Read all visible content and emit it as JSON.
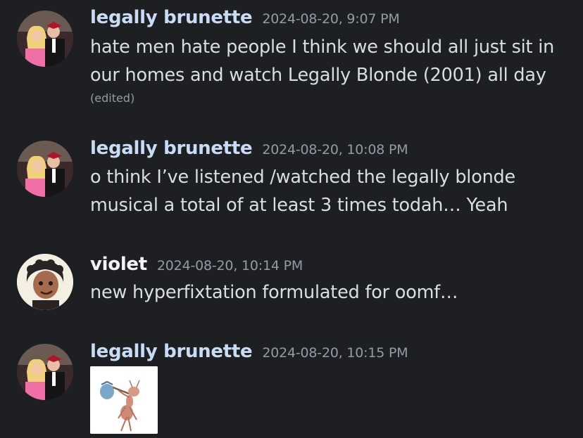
{
  "messages": [
    {
      "author": "legally brunette",
      "author_color": "#c9dcf6",
      "timestamp": "2024-08-20, 9:07 PM",
      "lines": [
        "hate men hate people I think we should all just sit in",
        "our homes and watch Legally Blonde (2001) all day"
      ],
      "edited_label": "(edited)"
    },
    {
      "author": "legally brunette",
      "author_color": "#c9dcf6",
      "timestamp": "2024-08-20, 10:08 PM",
      "lines": [
        "o think I’ve listened /watched the legally blonde",
        "musical a total of at least 3 times todah… Yeah"
      ]
    },
    {
      "author": "violet",
      "author_color": "#f2f3f5",
      "timestamp": "2024-08-20, 10:14 PM",
      "lines": [
        "new hyperfixtation formulated for oomf…"
      ]
    },
    {
      "author": "legally brunette",
      "author_color": "#c9dcf6",
      "timestamp": "2024-08-20, 10:15 PM",
      "attachment_icon": "ant-carrying-bindle-image"
    }
  ]
}
